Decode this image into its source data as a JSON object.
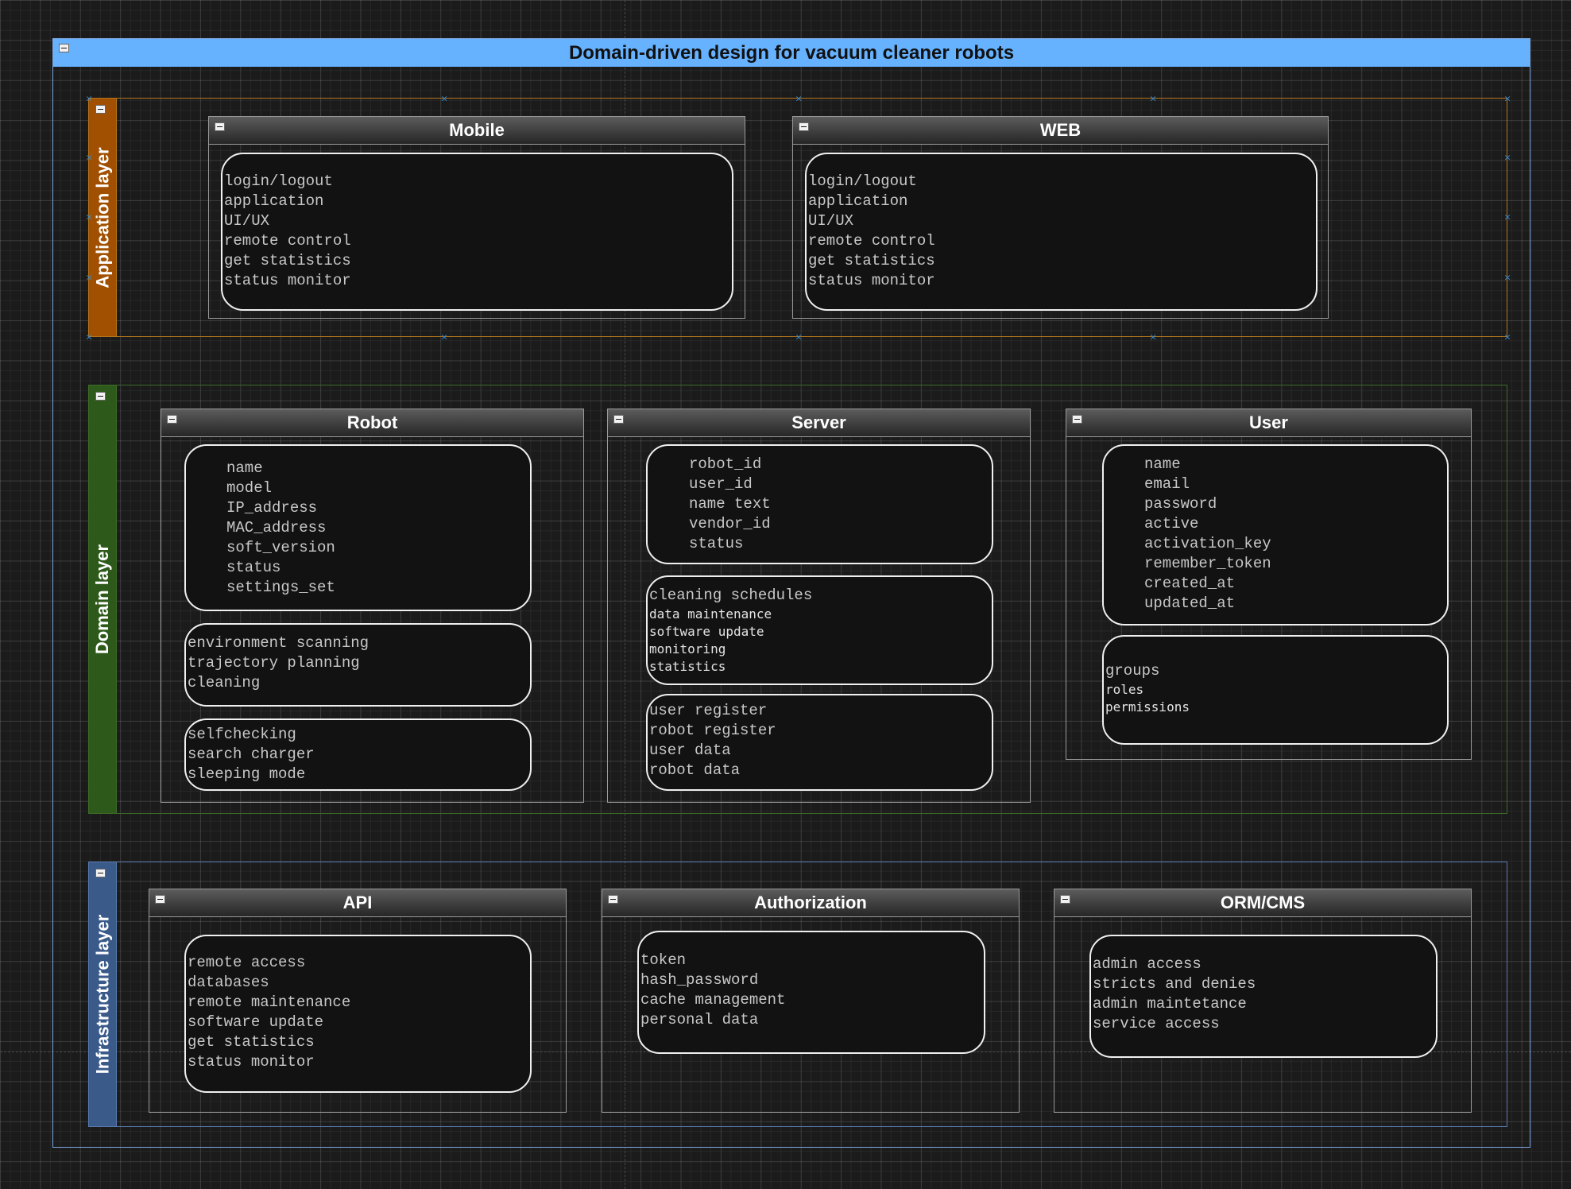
{
  "title": "Domain-driven design for vacuum cleaner robots",
  "layers": {
    "application": {
      "label": "Application layer",
      "mobile": {
        "title": "Mobile",
        "items": [
          "login/logout",
          "application",
          "UI/UX",
          "remote control",
          "get statistics",
          "status monitor"
        ]
      },
      "web": {
        "title": "WEB",
        "items": [
          "login/logout",
          "application",
          "UI/UX",
          "remote control",
          "get statistics",
          "status monitor"
        ]
      }
    },
    "domain": {
      "label": "Domain layer",
      "robot": {
        "title": "Robot",
        "attributes": [
          "name",
          "model",
          "IP_address",
          "MAC_address",
          "soft_version",
          "status",
          "settings_set"
        ],
        "group2": [
          "environment scanning",
          "trajectory planning",
          "cleaning"
        ],
        "group3": [
          "selfchecking",
          "search charger",
          "sleeping mode"
        ]
      },
      "server": {
        "title": "Server",
        "attributes": [
          "robot_id",
          "user_id",
          "name text",
          "vendor_id",
          "status"
        ],
        "group2_head": "cleaning schedules",
        "group2": [
          "data maintenance",
          "software update",
          "monitoring",
          "statistics"
        ],
        "group3": [
          "user register",
          "robot register",
          "user data",
          "robot data"
        ]
      },
      "user": {
        "title": "User",
        "attributes": [
          "name",
          "email",
          "password",
          "active",
          "activation_key",
          "remember_token",
          "created_at",
          "updated_at"
        ],
        "group2_head": "groups",
        "group2": [
          "roles",
          "permissions"
        ]
      }
    },
    "infrastructure": {
      "label": "Infrastructure layer",
      "api": {
        "title": "API",
        "items": [
          "remote access",
          "databases",
          "remote maintenance",
          "software update",
          "get statistics",
          "status monitor"
        ]
      },
      "authorization": {
        "title": "Authorization",
        "items": [
          "token",
          "hash_password",
          "cache management",
          "personal data"
        ]
      },
      "orm": {
        "title": "ORM/CMS",
        "items": [
          "admin access",
          "stricts and denies",
          "admin maintetance",
          "service access"
        ]
      }
    }
  },
  "colors": {
    "title_bar": "#66b2ff",
    "application": "#a05000",
    "domain": "#2d5a1a",
    "infrastructure": "#3a5a8a",
    "selection_handles": "#3b8fd6"
  }
}
